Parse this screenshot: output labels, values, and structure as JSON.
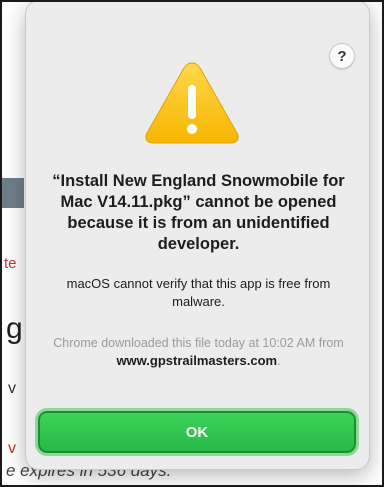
{
  "dialog": {
    "help_label": "?",
    "title": "“Install New England Snowmobile for Mac V14.11.pkg” cannot be opened because it is from an unidentified developer.",
    "message": "macOS cannot verify that this app is free from malware.",
    "info_text": "Chrome downloaded this file today at 10:02 AM from",
    "info_domain": "www.gpstrailmasters.com",
    "info_period": ".",
    "ok_label": "OK",
    "icon": "warning-triangle-icon",
    "colors": {
      "ok_button": "#28b846",
      "warning_yellow": "#fcc219",
      "dialog_bg": "#ececec"
    }
  },
  "background": {
    "fragment_te": "te",
    "fragment_g": "g",
    "fragment_w1": "v",
    "fragment_w2": "v",
    "expires_text": "e expires in 536 days."
  }
}
